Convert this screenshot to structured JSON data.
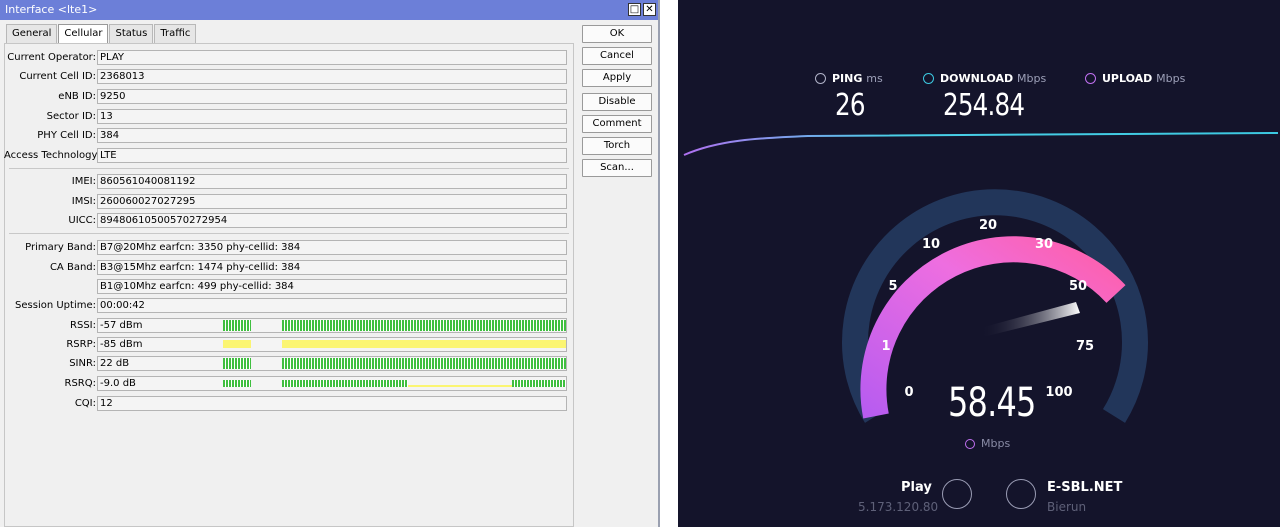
{
  "window": {
    "title": "Interface <lte1>",
    "tabs": [
      {
        "label": "General",
        "active": false
      },
      {
        "label": "Cellular",
        "active": true
      },
      {
        "label": "Status",
        "active": false
      },
      {
        "label": "Traffic",
        "active": false
      }
    ]
  },
  "fields": {
    "current_operator": {
      "label": "Current Operator:",
      "value": "PLAY"
    },
    "current_cell_id": {
      "label": "Current Cell ID:",
      "value": "2368013"
    },
    "enb_id": {
      "label": "eNB ID:",
      "value": "9250"
    },
    "sector_id": {
      "label": "Sector ID:",
      "value": "13"
    },
    "phy_cell_id": {
      "label": "PHY Cell ID:",
      "value": "384"
    },
    "access_technology": {
      "label": "Access Technology:",
      "value": "LTE"
    },
    "imei": {
      "label": "IMEI:",
      "value": "860561040081192"
    },
    "imsi": {
      "label": "IMSI:",
      "value": "260060027027295"
    },
    "uicc": {
      "label": "UICC:",
      "value": "89480610500570272954"
    },
    "primary_band": {
      "label": "Primary Band:",
      "value": "B7@20Mhz earfcn: 3350 phy-cellid: 384"
    },
    "ca_band": {
      "label": "CA Band:",
      "value": "B3@15Mhz earfcn: 1474 phy-cellid: 384"
    },
    "ca_band_2": {
      "value": "B1@10Mhz earfcn: 499 phy-cellid: 384"
    },
    "session_uptime": {
      "label": "Session Uptime:",
      "value": "00:00:42"
    },
    "rssi": {
      "label": "RSSI:",
      "value": "-57 dBm"
    },
    "rsrp": {
      "label": "RSRP:",
      "value": "-85 dBm"
    },
    "sinr": {
      "label": "SINR:",
      "value": "22 dB"
    },
    "rsrq": {
      "label": "RSRQ:",
      "value": "-9.0 dB"
    },
    "cqi": {
      "label": "CQI:",
      "value": "12"
    }
  },
  "buttons": {
    "ok": "OK",
    "cancel": "Cancel",
    "apply": "Apply",
    "disable": "Disable",
    "comment": "Comment",
    "torch": "Torch",
    "scan": "Scan..."
  },
  "speedtest": {
    "ping": {
      "label": "PING",
      "unit": "ms",
      "value": "26"
    },
    "download": {
      "label": "DOWNLOAD",
      "unit": "Mbps",
      "value": "254.84"
    },
    "upload": {
      "label": "UPLOAD",
      "unit": "Mbps"
    },
    "gauge_labels": [
      "0",
      "1",
      "5",
      "10",
      "20",
      "30",
      "50",
      "75",
      "100"
    ],
    "current_speed": "58.45",
    "current_unit": "Mbps",
    "isp": {
      "name": "Play",
      "ip": "5.173.120.80"
    },
    "server": {
      "name": "E-SBL.NET",
      "location": "Bierun"
    },
    "colors": {
      "pink": "#ff5fb0",
      "purple": "#b85cf0",
      "cyan": "#3cc8e0",
      "track": "#223658",
      "bg": "#14142b"
    }
  }
}
